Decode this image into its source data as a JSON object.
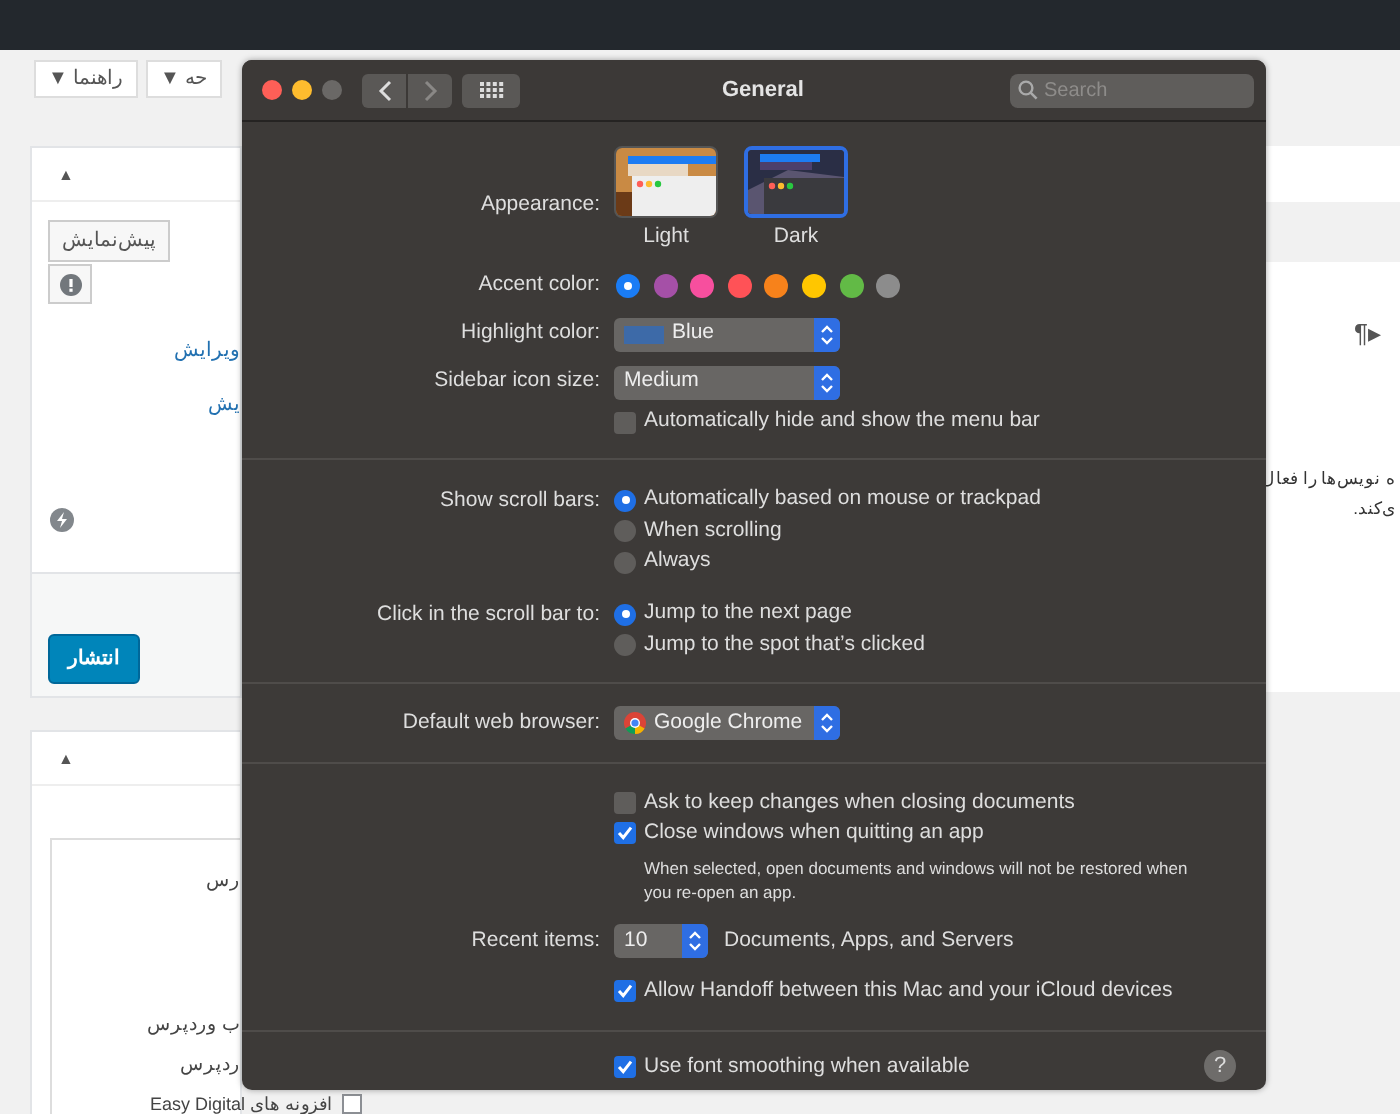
{
  "background_page": {
    "header_buttons": [
      "حه ▼",
      "راهنما ▼"
    ],
    "publish_box": {
      "collapse": "▲",
      "preview_button": "پیش‌نمایش",
      "links": [
        "ویرایش",
        "یش"
      ],
      "publish_button": "انتشار"
    },
    "category_box": {
      "collapse": "▲",
      "items": [
        "رس",
        "ب وردپرس",
        "ردپرس"
      ],
      "last_item": {
        "text": "افزونه های Easy Digital",
        "checked": false
      }
    },
    "editor_side": {
      "paragraph_icon": "¶▸",
      "lines": [
        "ه نویس‌ها را فعال",
        "ی‌کند."
      ]
    }
  },
  "window": {
    "title": "General",
    "search": {
      "placeholder": "Search"
    },
    "sections": [
      {
        "rows": [
          {
            "kind": "appearance",
            "label": "Appearance:",
            "options": [
              {
                "label": "Light",
                "selected": false
              },
              {
                "label": "Dark",
                "selected": true
              }
            ]
          },
          {
            "kind": "swatches",
            "label": "Accent color:",
            "swatches": [
              {
                "color": "#1a7cf5",
                "selected": true
              },
              {
                "color": "#a550a7",
                "selected": false
              },
              {
                "color": "#f74f9e",
                "selected": false
              },
              {
                "color": "#ff5257",
                "selected": false
              },
              {
                "color": "#f7821b",
                "selected": false
              },
              {
                "color": "#ffc600",
                "selected": false
              },
              {
                "color": "#62ba46",
                "selected": false
              },
              {
                "color": "#8c8c8c",
                "selected": false
              }
            ]
          },
          {
            "kind": "color_popup",
            "label": "Highlight color:",
            "value": "Blue"
          },
          {
            "kind": "popup",
            "label": "Sidebar icon size:",
            "value": "Medium"
          },
          {
            "kind": "checkbox",
            "text": "Automatically hide and show the menu bar",
            "checked": false
          }
        ]
      },
      {
        "rows": [
          {
            "kind": "radios",
            "label": "Show scroll bars:",
            "options": [
              {
                "text": "Automatically based on mouse or trackpad",
                "selected": true
              },
              {
                "text": "When scrolling",
                "selected": false
              },
              {
                "text": "Always",
                "selected": false
              }
            ]
          },
          {
            "kind": "radios",
            "label": "Click in the scroll bar to:",
            "options": [
              {
                "text": "Jump to the next page",
                "selected": true
              },
              {
                "text": "Jump to the spot that’s clicked",
                "selected": false
              }
            ]
          }
        ]
      },
      {
        "rows": [
          {
            "kind": "app_popup",
            "label": "Default web browser:",
            "value": "Google Chrome"
          }
        ]
      },
      {
        "rows": [
          {
            "kind": "checkbox",
            "text": "Ask to keep changes when closing documents",
            "checked": false
          },
          {
            "kind": "checkbox",
            "text": "Close windows when quitting an app",
            "checked": true
          },
          {
            "kind": "note",
            "text": "When selected, open documents and windows will not be restored when you re-open an app."
          },
          {
            "kind": "popup",
            "label": "Recent items:",
            "value": "10",
            "after": "Documents, Apps, and Servers"
          },
          {
            "kind": "checkbox",
            "text": "Allow Handoff between this Mac and your iCloud devices",
            "checked": true
          }
        ]
      },
      {
        "rows": [
          {
            "kind": "checkbox",
            "text": "Use font smoothing when available",
            "checked": true
          }
        ],
        "help": "?"
      }
    ]
  }
}
